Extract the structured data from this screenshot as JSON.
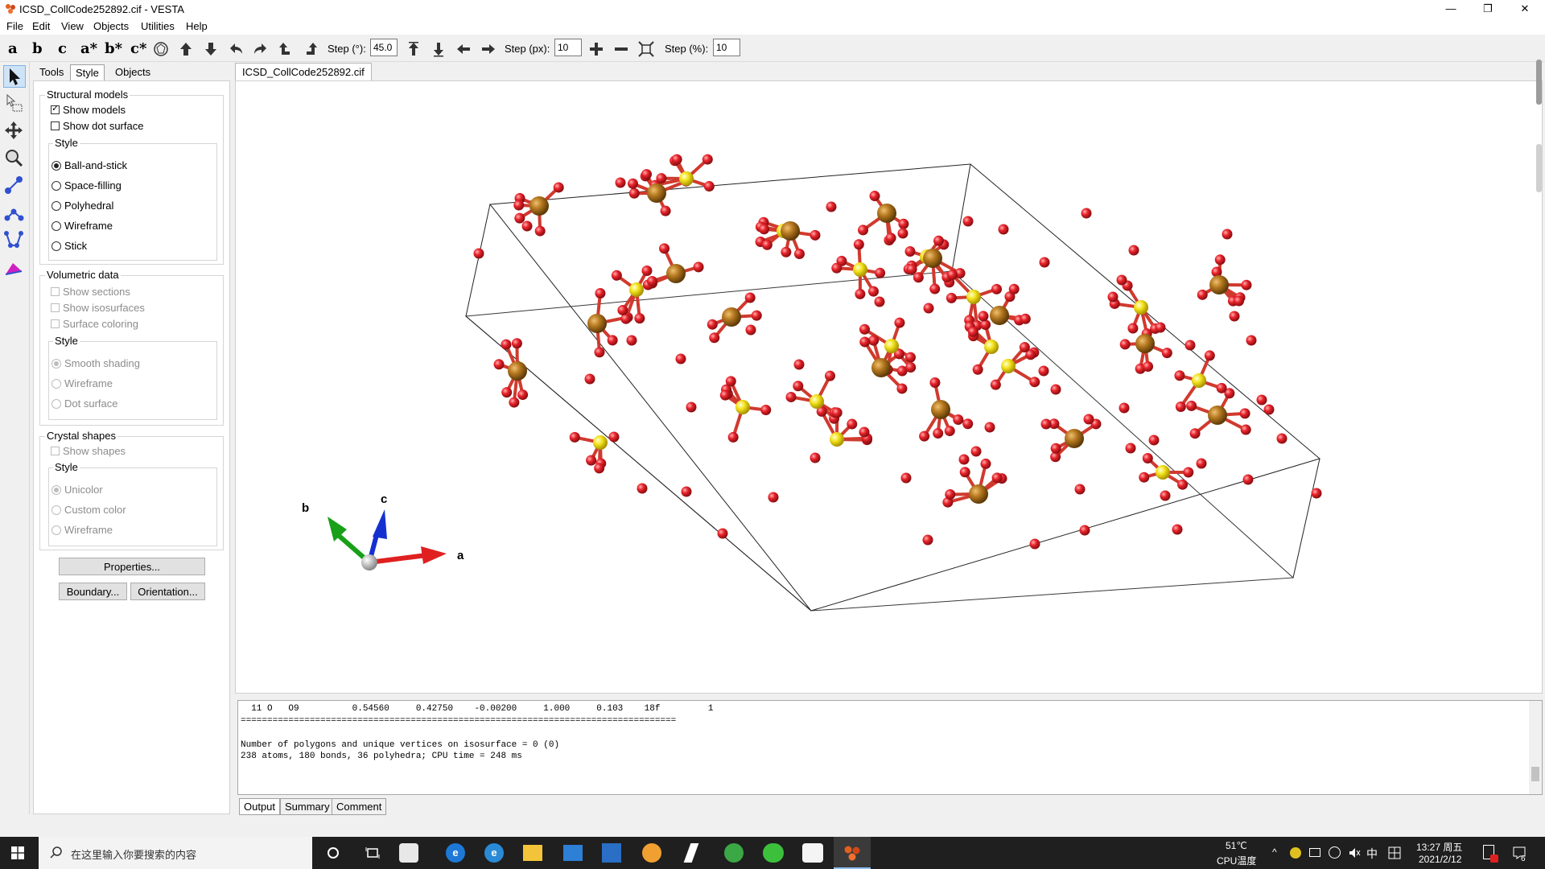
{
  "window": {
    "title": "ICSD_CollCode252892.cif - VESTA",
    "controls": {
      "minimize": "—",
      "maximize": "❐",
      "close": "✕"
    }
  },
  "menu": [
    "File",
    "Edit",
    "View",
    "Objects",
    "Utilities",
    "Help"
  ],
  "toolbar": {
    "letters": [
      "a",
      "b",
      "c",
      "a*",
      "b*",
      "c*"
    ],
    "step_deg_label": "Step (°):",
    "step_deg_value": "45.0",
    "step_px_label": "Step (px):",
    "step_px_value": "10",
    "step_pct_label": "Step (%):",
    "step_pct_value": "10"
  },
  "panel": {
    "tabs": [
      "Tools",
      "Style",
      "Objects"
    ],
    "structural": {
      "title": "Structural models",
      "show_models": "Show models",
      "show_dot_surface": "Show dot surface",
      "style_title": "Style",
      "styles": [
        "Ball-and-stick",
        "Space-filling",
        "Polyhedral",
        "Wireframe",
        "Stick"
      ]
    },
    "volumetric": {
      "title": "Volumetric data",
      "show_sections": "Show sections",
      "show_isosurfaces": "Show isosurfaces",
      "surface_coloring": "Surface coloring",
      "style_title": "Style",
      "styles": [
        "Smooth shading",
        "Wireframe",
        "Dot surface"
      ]
    },
    "crystal": {
      "title": "Crystal shapes",
      "show_shapes": "Show shapes",
      "style_title": "Style",
      "styles": [
        "Unicolor",
        "Custom color",
        "Wireframe"
      ]
    },
    "buttons": {
      "properties": "Properties...",
      "boundary": "Boundary...",
      "orientation": "Orientation..."
    }
  },
  "document_tab": "ICSD_CollCode252892.cif",
  "axes": {
    "a": "a",
    "b": "b",
    "c": "c"
  },
  "output": {
    "lines": [
      "  11 O   O9          0.54560     0.42750    -0.00200     1.000     0.103    18f         1",
      "==================================================================================",
      "",
      "Number of polygons and unique vertices on isosurface = 0 (0)",
      "238 atoms, 180 bonds, 36 polyhedra; CPU time = 248 ms"
    ],
    "tabs": [
      "Output",
      "Summary",
      "Comment"
    ]
  },
  "taskbar": {
    "search_placeholder": "在这里输入你要搜索的内容",
    "temp": "51℃",
    "temp_label": "CPU温度",
    "ime": "中",
    "time": "13:27 周五",
    "date": "2021/2/12",
    "notifications": "6"
  },
  "colors": {
    "oxygen": "#e8232b",
    "sulfur": "#f2e21c",
    "iron": "#b5781f",
    "bond": "#c0392b",
    "axis_a": "#e02020",
    "axis_b": "#18a018",
    "axis_c": "#1530d0"
  }
}
